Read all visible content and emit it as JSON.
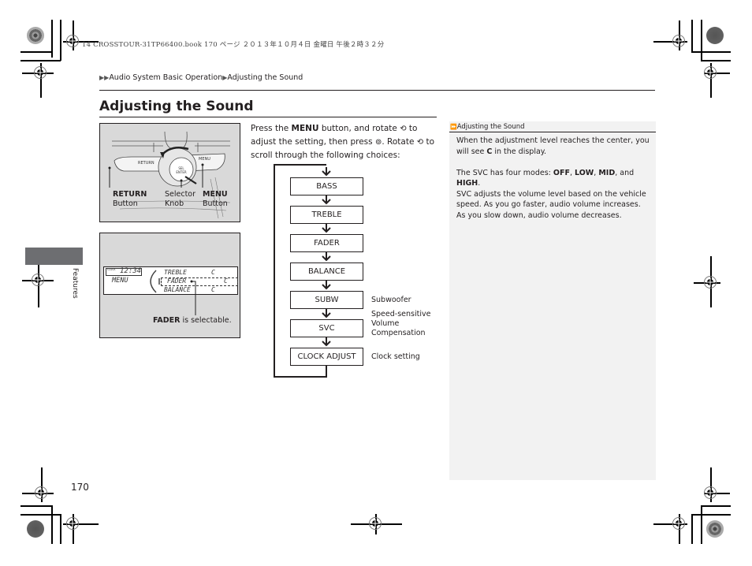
{
  "file_header": "14 CROSSTOUR-31TP66400.book  170 ページ  ２０１３年１０月４日  金曜日  午後２時３２分",
  "breadcrumb": {
    "items": [
      "Audio System Basic Operation",
      "Adjusting the Sound"
    ]
  },
  "page_title": "Adjusting the Sound",
  "section": {
    "label": "Features"
  },
  "page_number": "170",
  "figure_controls": {
    "return_label": "RETURN",
    "return_sub": "Button",
    "selector_label": "Selector",
    "selector_sub": "Knob",
    "menu_label": "MENU",
    "menu_sub": "Button",
    "panel_return_text": "RETURN",
    "panel_menu_text": "MENU",
    "knob_text": "SEL ENTER"
  },
  "figure_display": {
    "clock_tag": "CLOCK",
    "time": "12:34",
    "menu_text": "MENU",
    "rows": [
      {
        "name": "TREBLE",
        "value": "C"
      },
      {
        "name": "FADER",
        "value": "C"
      },
      {
        "name": "BALANCE",
        "value": "C"
      }
    ],
    "callout_bold": "FADER",
    "callout_rest": " is selectable."
  },
  "intro": {
    "part1": "Press the ",
    "bold1": "MENU",
    "part2": " button, and rotate ",
    "part3": " to adjust the setting, then press ",
    "part4": ". Rotate ",
    "part5": " to scroll through the following choices:",
    "rotate_icon": "rotate-knob-icon",
    "press_icon": "press-knob-icon"
  },
  "flowchart": {
    "steps": [
      {
        "label": "BASS",
        "note": ""
      },
      {
        "label": "TREBLE",
        "note": ""
      },
      {
        "label": "FADER",
        "note": ""
      },
      {
        "label": "BALANCE",
        "note": ""
      },
      {
        "label": "SUBW",
        "note": "Subwoofer"
      },
      {
        "label": "SVC",
        "note": "Speed-sensitive\nVolume\nCompensation"
      },
      {
        "label": "CLOCK ADJUST",
        "note": "Clock setting"
      }
    ]
  },
  "sidenote": {
    "heading": "Adjusting the Sound",
    "p1_a": "When the adjustment level reaches the center, you will see ",
    "p1_bold": "C",
    "p1_b": " in the display.",
    "p2_a": "The SVC has four modes: ",
    "p2_m1": "OFF",
    "p2_m2": "LOW",
    "p2_m3": "MID",
    "p2_and": ", and ",
    "p2_m4": "HIGH",
    "p3": "SVC adjusts the volume level based on the vehicle speed. As you go faster, audio volume increases. As you slow down, audio volume decreases."
  }
}
